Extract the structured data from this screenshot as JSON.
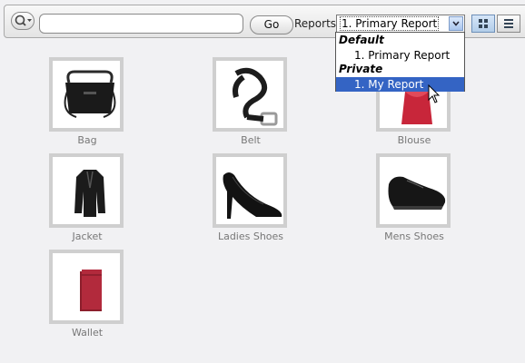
{
  "toolbar": {
    "search_icon": "magnifier-with-dropdown-icon",
    "search_value": "",
    "go_label": "Go",
    "reports_label": "Reports",
    "selected_report": "1. Primary Report",
    "view_icons": [
      "grid-view-icon",
      "list-view-icon"
    ]
  },
  "dropdown": {
    "groups": [
      {
        "label": "Default",
        "options": [
          "1. Primary Report"
        ]
      },
      {
        "label": "Private",
        "options": [
          "1. My Report"
        ]
      }
    ],
    "highlighted": "1. My Report"
  },
  "products": [
    {
      "name": "Bag",
      "icon": "bag-icon"
    },
    {
      "name": "Belt",
      "icon": "belt-icon"
    },
    {
      "name": "Blouse",
      "icon": "blouse-icon"
    },
    {
      "name": "Jacket",
      "icon": "jacket-icon"
    },
    {
      "name": "Ladies Shoes",
      "icon": "ladies-shoes-icon"
    },
    {
      "name": "Mens Shoes",
      "icon": "mens-shoes-icon"
    },
    {
      "name": "Wallet",
      "icon": "wallet-icon"
    }
  ],
  "colors": {
    "selection": "#3464c4",
    "tile_border": "#cfcfcf",
    "caption": "#777777"
  }
}
